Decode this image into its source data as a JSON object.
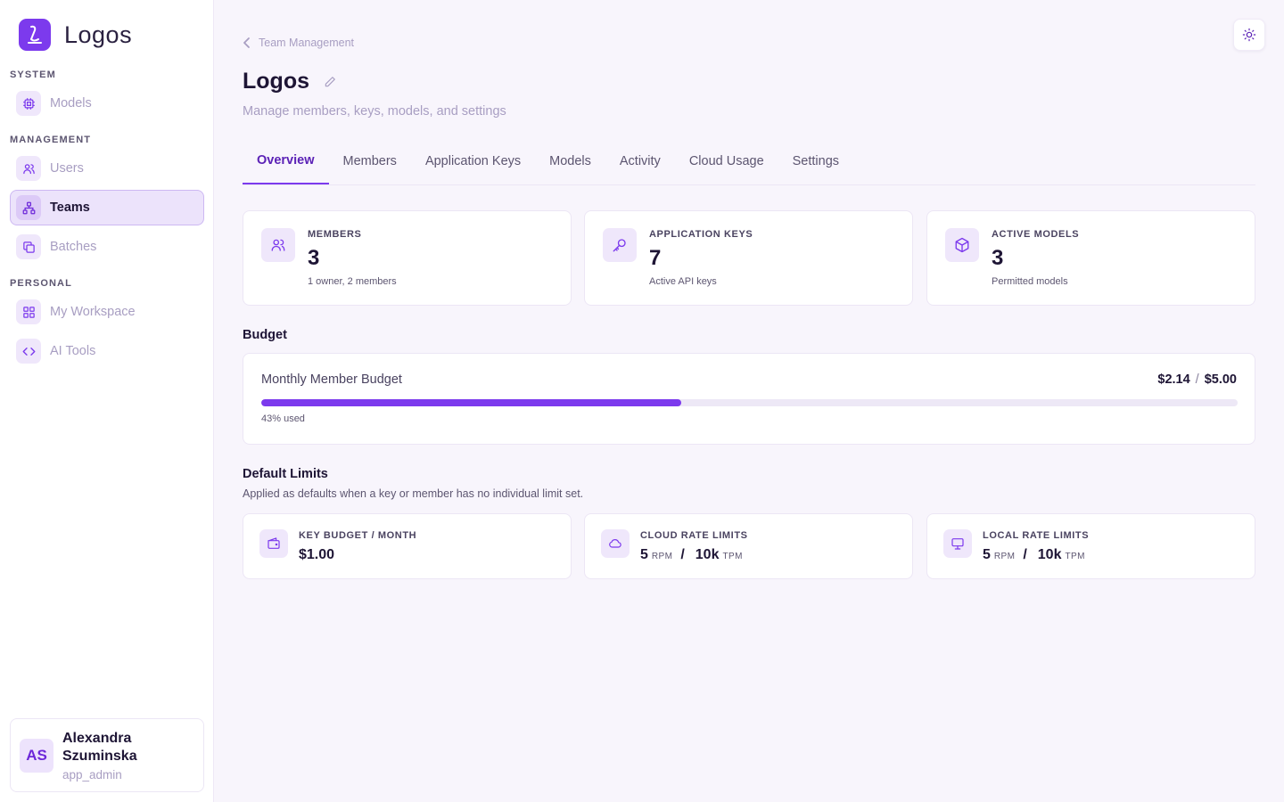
{
  "app": {
    "name": "Logos"
  },
  "sidebar": {
    "sections": [
      {
        "label": "SYSTEM",
        "items": [
          {
            "label": "Models",
            "icon": "cpu-icon"
          }
        ]
      },
      {
        "label": "MANAGEMENT",
        "items": [
          {
            "label": "Users",
            "icon": "users-icon"
          },
          {
            "label": "Teams",
            "icon": "network-icon",
            "active": true
          },
          {
            "label": "Batches",
            "icon": "copy-icon"
          }
        ]
      },
      {
        "label": "PERSONAL",
        "items": [
          {
            "label": "My Workspace",
            "icon": "grid-icon"
          },
          {
            "label": "AI Tools",
            "icon": "code-icon"
          }
        ]
      }
    ],
    "user": {
      "initials": "AS",
      "name": "Alexandra Szuminska",
      "role": "app_admin"
    }
  },
  "header": {
    "breadcrumb": "Team Management",
    "title": "Logos",
    "subtitle": "Manage members, keys, models, and settings"
  },
  "tabs": [
    {
      "label": "Overview",
      "active": true
    },
    {
      "label": "Members"
    },
    {
      "label": "Application Keys"
    },
    {
      "label": "Models"
    },
    {
      "label": "Activity"
    },
    {
      "label": "Cloud Usage"
    },
    {
      "label": "Settings"
    }
  ],
  "stats": [
    {
      "label": "MEMBERS",
      "value": "3",
      "caption": "1 owner, 2 members",
      "icon": "users-icon"
    },
    {
      "label": "APPLICATION KEYS",
      "value": "7",
      "caption": "Active API keys",
      "icon": "key-icon"
    },
    {
      "label": "ACTIVE MODELS",
      "value": "3",
      "caption": "Permitted models",
      "icon": "box-icon"
    }
  ],
  "budget": {
    "heading": "Budget",
    "title": "Monthly Member Budget",
    "spent": "$2.14",
    "separator": "/",
    "limit": "$5.00",
    "percent_used": 43,
    "used_label": "43% used"
  },
  "limits": {
    "heading": "Default Limits",
    "description": "Applied as defaults when a key or member has no individual limit set.",
    "key_budget": {
      "label": "KEY BUDGET / MONTH",
      "value": "$1.00",
      "icon": "wallet-icon"
    },
    "cloud": {
      "label": "CLOUD RATE LIMITS",
      "rpm": "5",
      "rpm_unit": "RPM",
      "slash": "/",
      "tpm": "10k",
      "tpm_unit": "TPM",
      "icon": "cloud-icon"
    },
    "local": {
      "label": "LOCAL RATE LIMITS",
      "rpm": "5",
      "rpm_unit": "RPM",
      "slash": "/",
      "tpm": "10k",
      "tpm_unit": "TPM",
      "icon": "monitor-icon"
    }
  },
  "colors": {
    "accent": "#7c3aed",
    "accent_light": "#efe7fb",
    "background": "#f8f5fc",
    "muted_text": "#a89ec2"
  }
}
